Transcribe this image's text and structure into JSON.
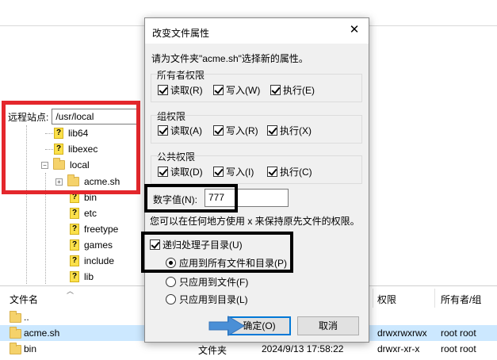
{
  "dialog": {
    "title": "改变文件属性",
    "description": "请为文件夹\"acme.sh\"选择新的属性。",
    "owner": {
      "title": "所有者权限",
      "read": "读取(R)",
      "write": "写入(W)",
      "execute": "执行(E)"
    },
    "group": {
      "title": "组权限",
      "read": "读取(A)",
      "write": "写入(R)",
      "execute": "执行(X)"
    },
    "public": {
      "title": "公共权限",
      "read": "读取(D)",
      "write": "写入(I)",
      "execute": "执行(C)"
    },
    "numeric_label": "数字值(N):",
    "numeric_value": "777",
    "hint": "您可以在任何地方使用 x 来保持原先文件的权限。",
    "recurse_label": "递归处理子目录(U)",
    "apply_all": "应用到所有文件和目录(P)",
    "apply_files": "只应用到文件(F)",
    "apply_dirs": "只应用到目录(L)",
    "ok": "确定(O)",
    "cancel": "取消",
    "close_glyph": "✕"
  },
  "remote": {
    "label": "远程站点:",
    "path": "/usr/local"
  },
  "tree": [
    {
      "name": "lib64",
      "icon": "unknown-folder-icon"
    },
    {
      "name": "libexec",
      "icon": "unknown-folder-icon"
    },
    {
      "name": "local",
      "icon": "folder-icon"
    },
    {
      "name": "acme.sh",
      "icon": "folder-icon"
    },
    {
      "name": "bin",
      "icon": "unknown-folder-icon"
    },
    {
      "name": "etc",
      "icon": "unknown-folder-icon"
    },
    {
      "name": "freetype",
      "icon": "unknown-folder-icon"
    },
    {
      "name": "games",
      "icon": "unknown-folder-icon"
    },
    {
      "name": "include",
      "icon": "unknown-folder-icon"
    },
    {
      "name": "lib",
      "icon": "unknown-folder-icon"
    }
  ],
  "list": {
    "headers": {
      "filename": "文件名",
      "permissions": "权限",
      "owner_group": "所有者/组"
    },
    "rows": [
      {
        "name": "..",
        "type": "",
        "modified": "",
        "permissions": "",
        "owner": ""
      },
      {
        "name": "acme.sh",
        "type": "",
        "modified": "",
        "permissions": "drwxrwxrwx",
        "owner": "root root"
      },
      {
        "name": "bin",
        "type": "文件夹",
        "modified": "2024/9/13 17:58:22",
        "permissions": "drwxr-xr-x",
        "owner": "root root"
      }
    ]
  },
  "colors": {
    "annotation_red": "#e4272c",
    "annotation_black": "#000000",
    "arrow_blue": "#4a8fd6",
    "selection": "#cce8ff"
  }
}
